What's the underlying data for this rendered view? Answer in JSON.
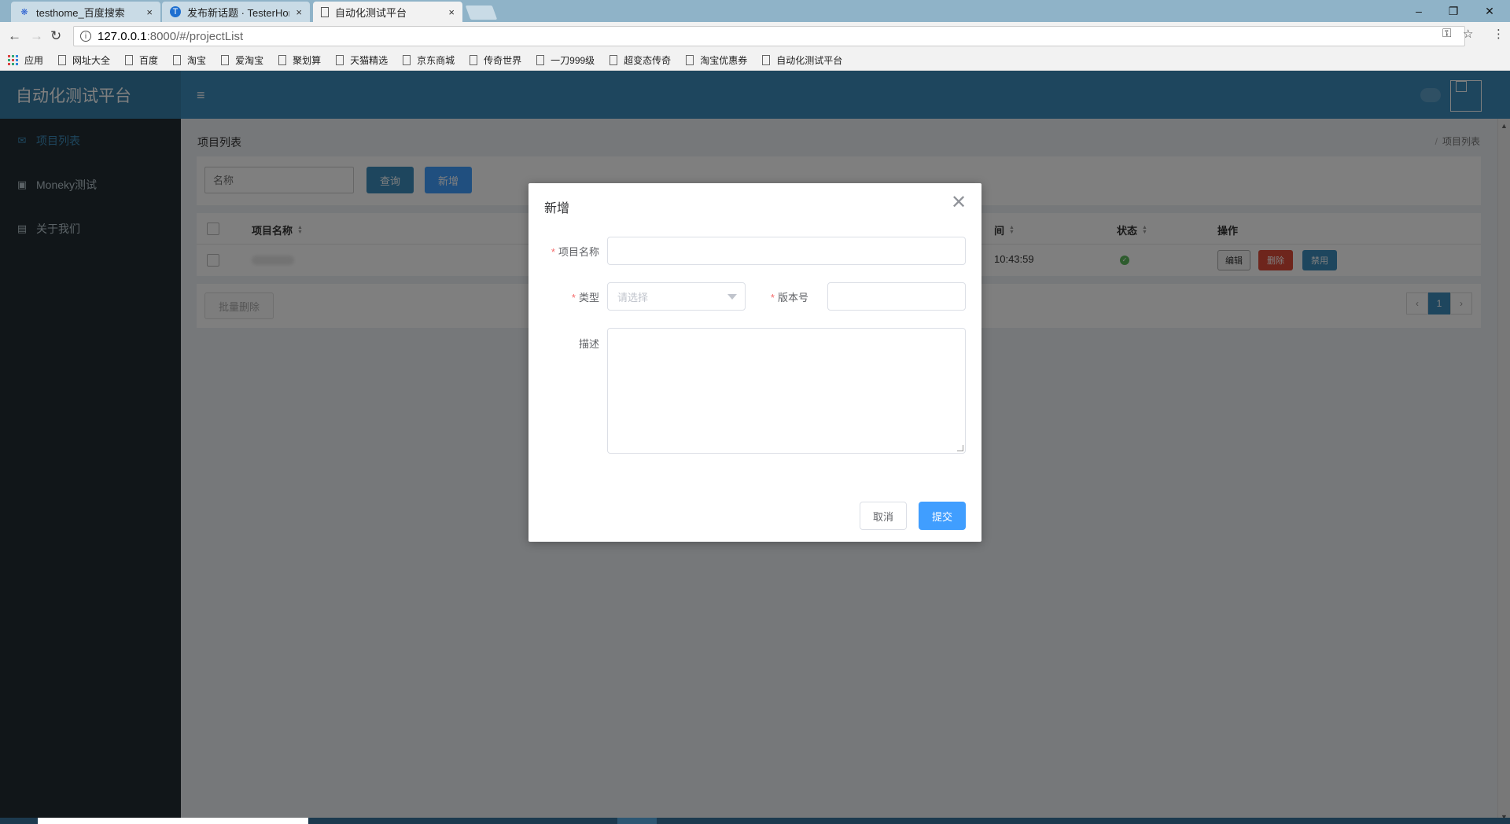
{
  "browser": {
    "tabs": [
      {
        "title": "testhome_百度搜索",
        "close": "×"
      },
      {
        "title": "发布新话题 · TesterHome",
        "close": "×"
      },
      {
        "title": "自动化测试平台",
        "close": "×"
      }
    ],
    "url_host": "127.0.0.1",
    "url_path": ":8000/#/projectList",
    "info_glyph": "i",
    "win_minimize": "–",
    "win_restore": "❐",
    "win_close": "✕",
    "bookmarks": [
      "应用",
      "网址大全",
      "百度",
      "淘宝",
      "爱淘宝",
      "聚划算",
      "天猫精选",
      "京东商城",
      "传奇世界",
      "一刀999级",
      "超变态传奇",
      "淘宝优惠券",
      "自动化测试平台"
    ]
  },
  "app": {
    "brand": "自动化测试平台",
    "menu_toggle": "≡",
    "sidebar": [
      {
        "label": "项目列表",
        "icon": "envelope-icon",
        "glyph": "✉"
      },
      {
        "label": "Moneky测试",
        "icon": "id-card-icon",
        "glyph": "▣"
      },
      {
        "label": "关于我们",
        "icon": "contact-card-icon",
        "glyph": "▤"
      }
    ],
    "page_title": "项目列表",
    "breadcrumb_sep": "/",
    "breadcrumb": "项目列表",
    "search": {
      "placeholder": "名称",
      "query_label": "查询",
      "add_label": "新增"
    },
    "table": {
      "headers": [
        "项目名称",
        "间",
        "状态",
        "操作"
      ],
      "rows": [
        {
          "time": "10:43:59",
          "status_glyph": "✓",
          "edit": "编辑",
          "delete": "删除",
          "disable": "禁用"
        }
      ]
    },
    "batch_delete": "批量删除",
    "pagination": {
      "prev": "‹",
      "current": "1",
      "next": "›"
    }
  },
  "dialog": {
    "title": "新增",
    "close": "✕",
    "required_mark": "*",
    "fields": {
      "name_label": "项目名称",
      "type_label": "类型",
      "type_placeholder": "请选择",
      "version_label": "版本号",
      "desc_label": "描述"
    },
    "cancel": "取消",
    "submit": "提交"
  },
  "colors": {
    "header": "#3c8dbc",
    "sidebar": "#222d32",
    "primary": "#409eff",
    "danger": "#dd4b39",
    "success": "#5cb85c"
  }
}
